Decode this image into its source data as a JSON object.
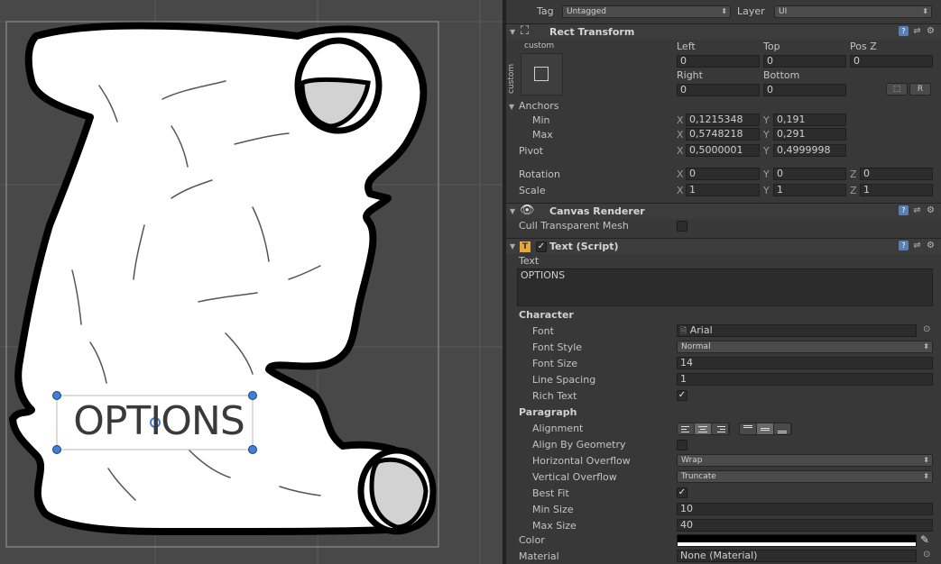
{
  "scene": {
    "label_text": "OPTIONS"
  },
  "header": {
    "tag_label": "Tag",
    "tag_value": "Untagged",
    "layer_label": "Layer",
    "layer_value": "UI"
  },
  "rect_transform": {
    "title": "Rect Transform",
    "anchor_preset_label": "custom",
    "anchor_preset_side_label": "custom",
    "left_label": "Left",
    "left": "0",
    "top_label": "Top",
    "top": "0",
    "posz_label": "Pos Z",
    "posz": "0",
    "right_label": "Right",
    "right": "0",
    "bottom_label": "Bottom",
    "bottom": "0",
    "r_button": "R",
    "anchors_label": "Anchors",
    "min_label": "Min",
    "min_x": "0,1215348",
    "min_y": "0,191",
    "max_label": "Max",
    "max_x": "0,5748218",
    "max_y": "0,291",
    "pivot_label": "Pivot",
    "pivot_x": "0,5000001",
    "pivot_y": "0,4999998",
    "rotation_label": "Rotation",
    "rot_x": "0",
    "rot_y": "0",
    "rot_z": "0",
    "scale_label": "Scale",
    "scale_x": "1",
    "scale_y": "1",
    "scale_z": "1",
    "x": "X",
    "y": "Y",
    "z": "Z"
  },
  "canvas_renderer": {
    "title": "Canvas Renderer",
    "cull_label": "Cull Transparent Mesh"
  },
  "text_script": {
    "title": "Text (Script)",
    "text_label": "Text",
    "text_value": "OPTIONS",
    "character_label": "Character",
    "font_label": "Font",
    "font_value": "Arial",
    "font_style_label": "Font Style",
    "font_style_value": "Normal",
    "font_size_label": "Font Size",
    "font_size_value": "14",
    "line_spacing_label": "Line Spacing",
    "line_spacing_value": "1",
    "rich_text_label": "Rich Text",
    "paragraph_label": "Paragraph",
    "alignment_label": "Alignment",
    "align_geom_label": "Align By Geometry",
    "h_overflow_label": "Horizontal Overflow",
    "h_overflow_value": "Wrap",
    "v_overflow_label": "Vertical Overflow",
    "v_overflow_value": "Truncate",
    "best_fit_label": "Best Fit",
    "min_size_label": "Min Size",
    "min_size_value": "10",
    "max_size_label": "Max Size",
    "max_size_value": "40",
    "color_label": "Color",
    "material_label": "Material",
    "material_value": "None (Material)"
  },
  "colors": {
    "panel": "#383838",
    "scene": "#484848",
    "field": "#2c2c2c",
    "handle": "#3f7fd6",
    "scroll_fill": "#ffffff",
    "scroll_shadow": "#d0d0d0"
  },
  "check_mark": "✓"
}
